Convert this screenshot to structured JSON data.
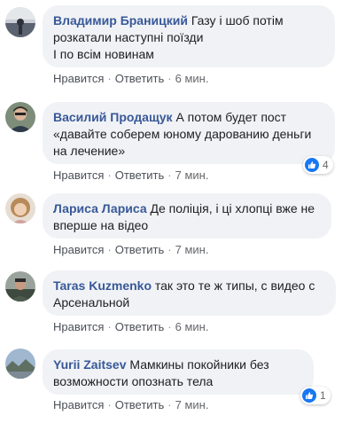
{
  "comments": [
    {
      "author": "Владимир Браницкий",
      "line1": "Газу і шоб потім",
      "line2": "розкатали наступні поїзди",
      "line3": "І по всім новинам",
      "like_label": "Нравится",
      "reply_label": "Ответить",
      "time": "6 мин.",
      "avatar_icon": "avatar-photo-icon"
    },
    {
      "author": "Василий Продащук",
      "line1": "А потом будет пост",
      "line2": "«давайте соберем юному дарованию деньги",
      "line3": "на лечение»",
      "like_label": "Нравится",
      "reply_label": "Ответить",
      "time": "7 мин.",
      "reaction_count": "4",
      "avatar_icon": "avatar-photo-icon"
    },
    {
      "author": "Лариса Лариса",
      "line1": "Де поліція, і ці хлопці вже не",
      "line2": "вперше на відео",
      "like_label": "Нравится",
      "reply_label": "Ответить",
      "time": "7 мин.",
      "avatar_icon": "avatar-photo-icon"
    },
    {
      "author": "Taras Kuzmenko",
      "line1": "так это те ж типы, с видео с",
      "line2": "Арсенальной",
      "like_label": "Нравится",
      "reply_label": "Ответить",
      "time": "6 мин.",
      "avatar_icon": "avatar-photo-icon"
    },
    {
      "author": "Yurii Zaitsev",
      "line1": "Мамкины покойники без",
      "line2": "возможности опознать тела",
      "like_label": "Нравится",
      "reply_label": "Ответить",
      "time": "7 мин.",
      "reaction_count": "1",
      "avatar_icon": "avatar-photo-icon"
    }
  ],
  "colors": {
    "author": "#385898",
    "bubble": "#f0f2f5",
    "like_blue": "#1877f2",
    "meta": "#65676b"
  },
  "icons": {
    "reaction": "thumbs-up-icon",
    "separator": "·"
  }
}
